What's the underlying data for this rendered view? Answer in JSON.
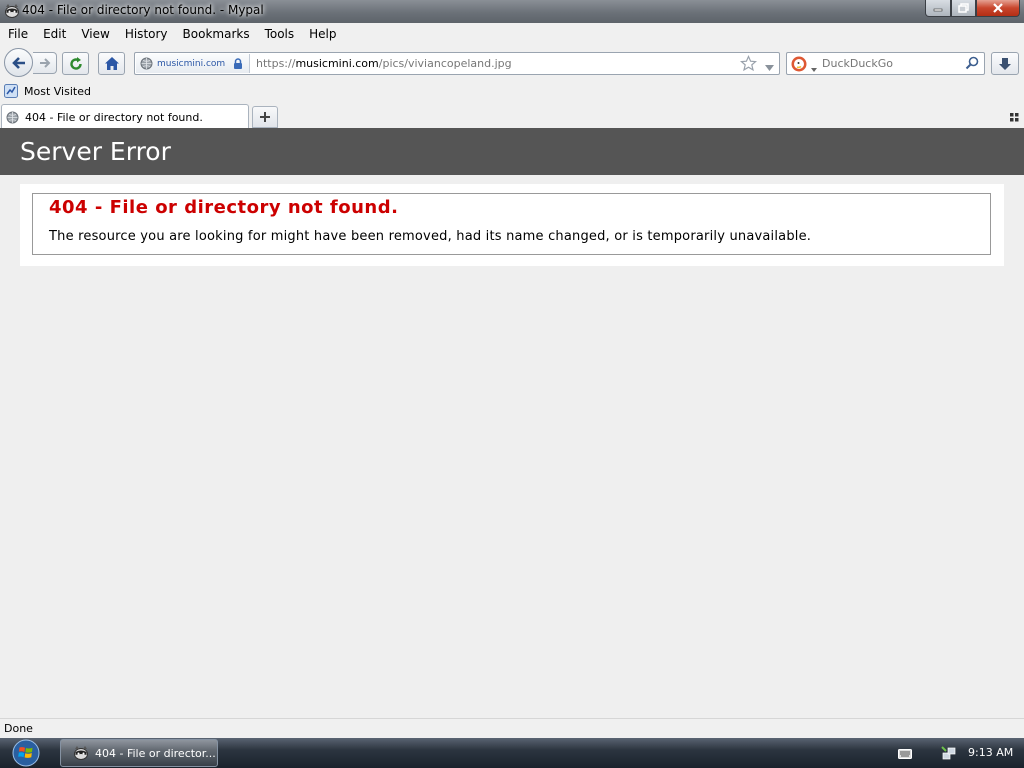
{
  "window": {
    "title": "404 - File or directory not found. - Mypal"
  },
  "menubar": {
    "items": [
      {
        "label": "File",
        "underline": "F"
      },
      {
        "label": "Edit",
        "underline": "E"
      },
      {
        "label": "View",
        "underline": "V"
      },
      {
        "label": "History",
        "underline": "s"
      },
      {
        "label": "Bookmarks",
        "underline": "B"
      },
      {
        "label": "Tools",
        "underline": "T"
      },
      {
        "label": "Help",
        "underline": "H"
      }
    ]
  },
  "navbar": {
    "identity_site": "musicmini.com",
    "url_prefix": "https://",
    "url_host": "musicmini.com",
    "url_path": "/pics/viviancopeland.jpg",
    "search_placeholder": "DuckDuckGo"
  },
  "bookmarks": {
    "most_visited": "Most Visited"
  },
  "tabs": [
    {
      "label": "404 - File or directory not found.",
      "active": true
    }
  ],
  "page": {
    "header": "Server Error",
    "error_title": "404 - File or directory not found.",
    "error_message": "The resource you are looking for might have been removed, had its name changed, or is temporarily unavailable."
  },
  "status": {
    "text": "Done"
  },
  "taskbar": {
    "task_label": "404 - File or director...",
    "clock": "9:13 AM"
  },
  "colors": {
    "header_bg": "#555555",
    "error_title": "#cc0000",
    "page_bg": "#efefef"
  }
}
